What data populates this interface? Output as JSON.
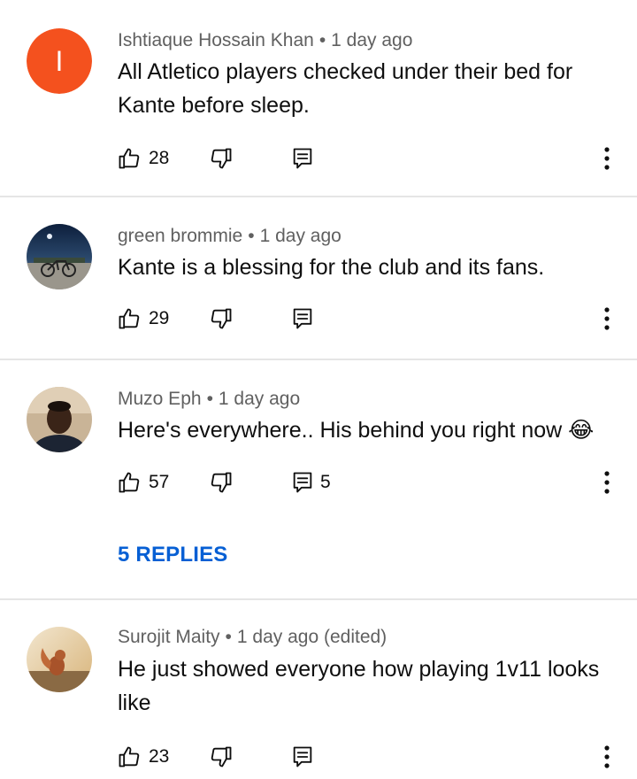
{
  "comments": [
    {
      "author": "Ishtiaque Hossain Khan",
      "separator": "•",
      "time": "1 day ago",
      "text": "All Atletico players checked under their bed for Kante before sleep.",
      "avatar_letter": "I",
      "avatar_color": "#f4511e",
      "likes": "28",
      "reply_count": ""
    },
    {
      "author": "green brommie",
      "separator": "•",
      "time": "1 day ago",
      "text": "Kante is a blessing for the club and its fans.",
      "likes": "29",
      "reply_count": ""
    },
    {
      "author": "Muzo Eph",
      "separator": "•",
      "time": "1 day ago",
      "text": "Here's everywhere.. His behind you right now 😂",
      "likes": "57",
      "reply_count": "5",
      "replies_label": "5 REPLIES"
    },
    {
      "author": "Surojit Maity",
      "separator": "•",
      "time": "1 day ago (edited)",
      "text": "He just showed everyone how playing 1v11 looks like",
      "likes": "23",
      "reply_count": ""
    }
  ],
  "icons": {
    "like": "thumbs-up-icon",
    "dislike": "thumbs-down-icon",
    "reply": "comment-reply-icon",
    "more": "more-vertical-icon"
  },
  "colors": {
    "link": "#065fd4",
    "meta": "#606060",
    "divider": "#e5e5e5"
  }
}
